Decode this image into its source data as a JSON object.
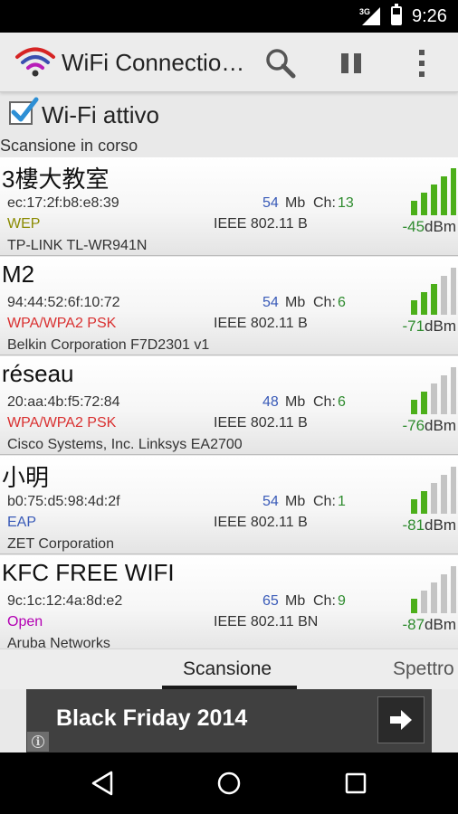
{
  "status_bar": {
    "network": "3G",
    "time": "9:26"
  },
  "app": {
    "title": "WiFi Connectio…",
    "icon": "wifi-logo-icon"
  },
  "toolbar": {
    "search_icon": "search-icon",
    "pause_icon": "pause-icon",
    "more_icon": "more-vert-icon"
  },
  "wifi_toggle": {
    "label": "Wi-Fi attivo",
    "checked": true
  },
  "scan_status": "Scansione in corso",
  "colors": {
    "wep": "#8a8a00",
    "wpa": "#d93030",
    "eap": "#3a5bb8",
    "open": "#b300b3",
    "signal_on": "#4caf1a",
    "signal_off": "#c4c4c4",
    "link": "#3a5bb8",
    "channel": "#2e8b2e"
  },
  "networks": [
    {
      "ssid": "3樓大教室",
      "mac": "ec:17:2f:b8:e8:39",
      "rate": "54",
      "rate_unit": "Mb",
      "ch_label": "Ch:",
      "channel": "13",
      "security": "WEP",
      "security_type": "wep",
      "standard": "IEEE 802.11 B",
      "vendor": "TP-LINK TL-WR941N",
      "dbm": "-45",
      "dbm_unit": "dBm",
      "signal_bars": 5
    },
    {
      "ssid": "M2",
      "mac": "94:44:52:6f:10:72",
      "rate": "54",
      "rate_unit": "Mb",
      "ch_label": "Ch:",
      "channel": "6",
      "security": "WPA/WPA2 PSK",
      "security_type": "wpa",
      "standard": "IEEE 802.11 B",
      "vendor": "Belkin Corporation F7D2301 v1",
      "dbm": "-71",
      "dbm_unit": "dBm",
      "signal_bars": 3
    },
    {
      "ssid": "réseau",
      "mac": "20:aa:4b:f5:72:84",
      "rate": "48",
      "rate_unit": "Mb",
      "ch_label": "Ch:",
      "channel": "6",
      "security": "WPA/WPA2 PSK",
      "security_type": "wpa",
      "standard": "IEEE 802.11 B",
      "vendor": "Cisco Systems, Inc. Linksys EA2700",
      "dbm": "-76",
      "dbm_unit": "dBm",
      "signal_bars": 2
    },
    {
      "ssid": "小明",
      "mac": "b0:75:d5:98:4d:2f",
      "rate": "54",
      "rate_unit": "Mb",
      "ch_label": "Ch:",
      "channel": "1",
      "security": "EAP",
      "security_type": "eap",
      "standard": "IEEE 802.11 B",
      "vendor": "ZET Corporation",
      "dbm": "-81",
      "dbm_unit": "dBm",
      "signal_bars": 2
    },
    {
      "ssid": "KFC FREE WIFI",
      "mac": "9c:1c:12:4a:8d:e2",
      "rate": "65",
      "rate_unit": "Mb",
      "ch_label": "Ch:",
      "channel": "9",
      "security": "Open",
      "security_type": "open",
      "standard": "IEEE 802.11 BN",
      "vendor": "Aruba Networks",
      "dbm": "-87",
      "dbm_unit": "dBm",
      "signal_bars": 1
    }
  ],
  "tabs": [
    {
      "label": "Scansione",
      "active": true
    },
    {
      "label": "Spettro",
      "active": false
    }
  ],
  "ad": {
    "text": "Black Friday 2014",
    "arrow_icon": "arrow-right-icon",
    "info_icon": "info-icon"
  },
  "nav_bar": {
    "back_icon": "back-icon",
    "home_icon": "home-icon",
    "recents_icon": "recents-icon"
  }
}
